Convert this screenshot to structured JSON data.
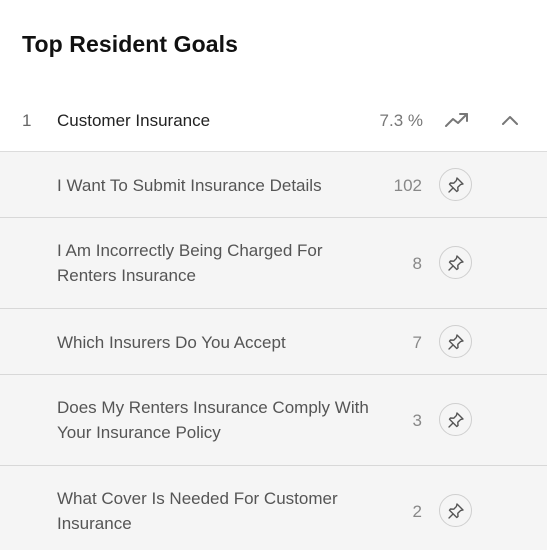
{
  "panel": {
    "title": "Top Resident Goals"
  },
  "goal": {
    "rank": "1",
    "label": "Customer Insurance",
    "percent": "7.3 %",
    "trend_icon": "trending-up-icon",
    "collapse_icon": "chevron-up-icon"
  },
  "subgoals": [
    {
      "label": "I Want To Submit Insurance Details",
      "count": "102"
    },
    {
      "label": "I Am Incorrectly Being Charged For Renters Insurance",
      "count": "8"
    },
    {
      "label": "Which Insurers Do You Accept",
      "count": "7"
    },
    {
      "label": "Does My Renters Insurance Comply With Your Insurance Policy",
      "count": "3"
    },
    {
      "label": "What Cover Is Needed For Customer Insurance",
      "count": "2"
    }
  ],
  "icons": {
    "pin": "pin-icon"
  },
  "colors": {
    "header_bg": "#ffffff",
    "sub_bg": "#f5f5f5",
    "divider": "#dcdcdc"
  }
}
